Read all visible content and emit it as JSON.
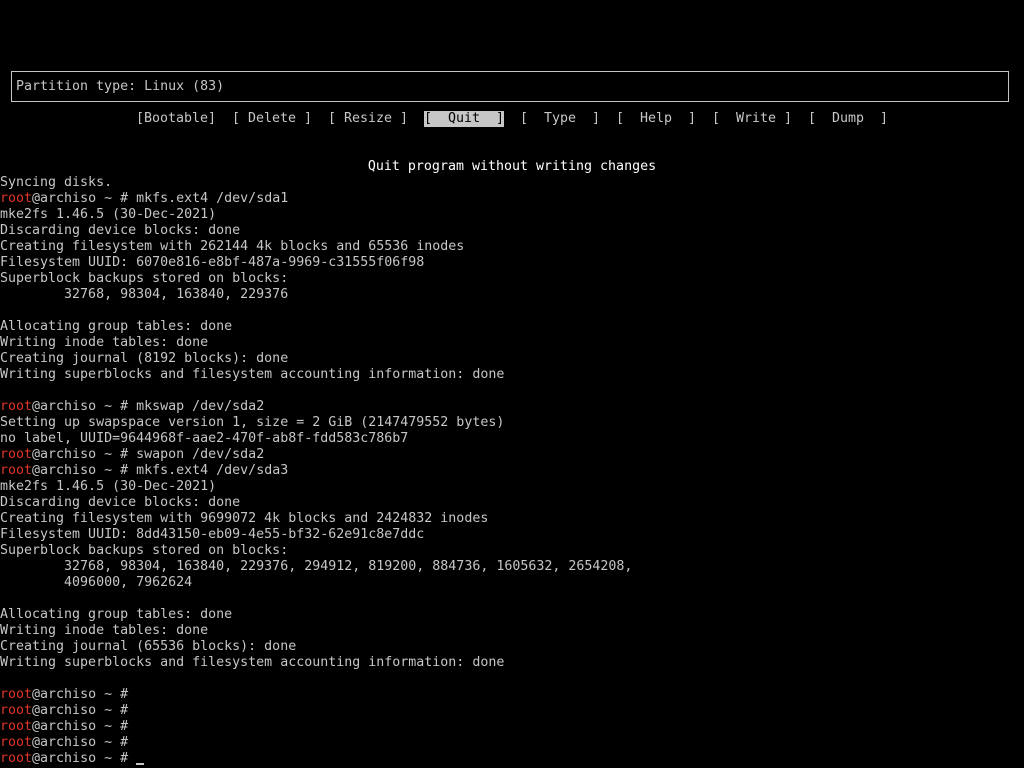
{
  "partition_info": "Partition type: Linux (83)",
  "menu": [
    {
      "label": "[Bootable]",
      "selected": false
    },
    {
      "label": "[ Delete ]",
      "selected": false
    },
    {
      "label": "[ Resize ]",
      "selected": false
    },
    {
      "label": "[  Quit  ]",
      "selected": true
    },
    {
      "label": "[  Type  ]",
      "selected": false
    },
    {
      "label": "[  Help  ]",
      "selected": false
    },
    {
      "label": "[  Write ]",
      "selected": false
    },
    {
      "label": "[  Dump  ]",
      "selected": false
    }
  ],
  "help_text": "Quit program without writing changes",
  "prompt": {
    "user": "root",
    "host_suffix": "@archiso ~ # "
  },
  "terminal_lines": [
    {
      "type": "out",
      "text": "Syncing disks."
    },
    {
      "type": "cmd",
      "text": "mkfs.ext4 /dev/sda1"
    },
    {
      "type": "out",
      "text": "mke2fs 1.46.5 (30-Dec-2021)"
    },
    {
      "type": "out",
      "text": "Discarding device blocks: done"
    },
    {
      "type": "out",
      "text": "Creating filesystem with 262144 4k blocks and 65536 inodes"
    },
    {
      "type": "out",
      "text": "Filesystem UUID: 6070e816-e8bf-487a-9969-c31555f06f98"
    },
    {
      "type": "out",
      "text": "Superblock backups stored on blocks:"
    },
    {
      "type": "out",
      "text": "        32768, 98304, 163840, 229376"
    },
    {
      "type": "out",
      "text": ""
    },
    {
      "type": "out",
      "text": "Allocating group tables: done"
    },
    {
      "type": "out",
      "text": "Writing inode tables: done"
    },
    {
      "type": "out",
      "text": "Creating journal (8192 blocks): done"
    },
    {
      "type": "out",
      "text": "Writing superblocks and filesystem accounting information: done"
    },
    {
      "type": "out",
      "text": ""
    },
    {
      "type": "cmd",
      "text": "mkswap /dev/sda2"
    },
    {
      "type": "out",
      "text": "Setting up swapspace version 1, size = 2 GiB (2147479552 bytes)"
    },
    {
      "type": "out",
      "text": "no label, UUID=9644968f-aae2-470f-ab8f-fdd583c786b7"
    },
    {
      "type": "cmd",
      "text": "swapon /dev/sda2"
    },
    {
      "type": "cmd",
      "text": "mkfs.ext4 /dev/sda3"
    },
    {
      "type": "out",
      "text": "mke2fs 1.46.5 (30-Dec-2021)"
    },
    {
      "type": "out",
      "text": "Discarding device blocks: done"
    },
    {
      "type": "out",
      "text": "Creating filesystem with 9699072 4k blocks and 2424832 inodes"
    },
    {
      "type": "out",
      "text": "Filesystem UUID: 8dd43150-eb09-4e55-bf32-62e91c8e7ddc"
    },
    {
      "type": "out",
      "text": "Superblock backups stored on blocks:"
    },
    {
      "type": "out",
      "text": "        32768, 98304, 163840, 229376, 294912, 819200, 884736, 1605632, 2654208,"
    },
    {
      "type": "out",
      "text": "        4096000, 7962624"
    },
    {
      "type": "out",
      "text": ""
    },
    {
      "type": "out",
      "text": "Allocating group tables: done"
    },
    {
      "type": "out",
      "text": "Writing inode tables: done"
    },
    {
      "type": "out",
      "text": "Creating journal (65536 blocks): done"
    },
    {
      "type": "out",
      "text": "Writing superblocks and filesystem accounting information: done"
    },
    {
      "type": "out",
      "text": ""
    },
    {
      "type": "cmd",
      "text": ""
    },
    {
      "type": "cmd",
      "text": ""
    },
    {
      "type": "cmd",
      "text": ""
    },
    {
      "type": "cmd",
      "text": ""
    },
    {
      "type": "cmd",
      "text": "",
      "cursor": true
    }
  ],
  "colors": {
    "background": "#000000",
    "foreground": "#c6c6c6",
    "prompt_user": "#e0342c",
    "highlight": "#ffffff"
  }
}
